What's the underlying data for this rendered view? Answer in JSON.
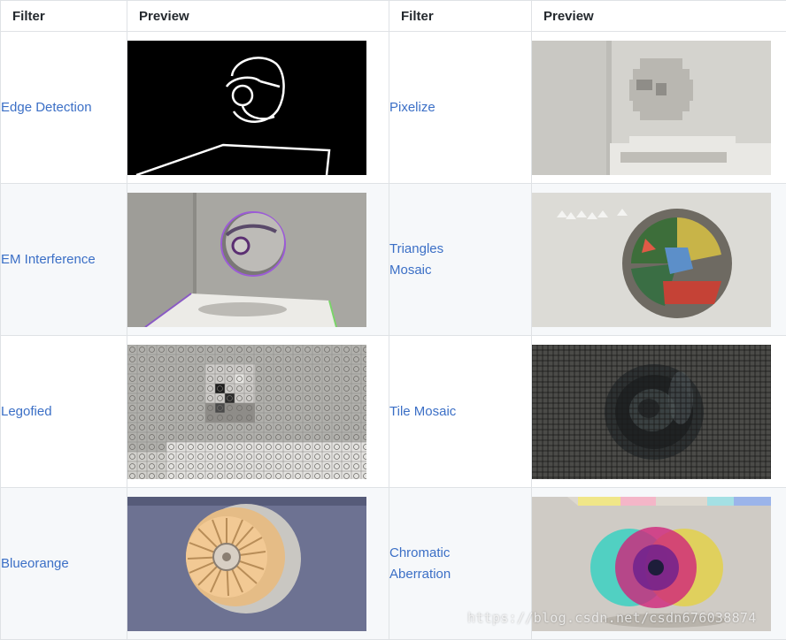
{
  "table": {
    "headers": [
      "Filter",
      "Preview",
      "Filter",
      "Preview"
    ],
    "rows": [
      {
        "left": {
          "name": "Edge Detection",
          "preview": "edge-detection-preview"
        },
        "right": {
          "name": "Pixelize",
          "preview": "pixelize-preview"
        }
      },
      {
        "left": {
          "name": "EM Interference",
          "preview": "em-interference-preview"
        },
        "right": {
          "name": "Triangles Mosaic",
          "preview": "triangles-mosaic-preview"
        }
      },
      {
        "left": {
          "name": "Legofied",
          "preview": "legofied-preview"
        },
        "right": {
          "name": "Tile Mosaic",
          "preview": "tile-mosaic-preview"
        }
      },
      {
        "left": {
          "name": "Blueorange",
          "preview": "blueorange-preview"
        },
        "right": {
          "name": "Chromatic Aberration",
          "preview": "chromatic-aberration-preview"
        }
      }
    ]
  },
  "watermark": "https://blog.csdn.net/csdn676038874",
  "colors": {
    "link": "#3b6fc6",
    "border": "#dfe2e5",
    "row_alt": "#f6f8fa",
    "header_text": "#24292e"
  }
}
